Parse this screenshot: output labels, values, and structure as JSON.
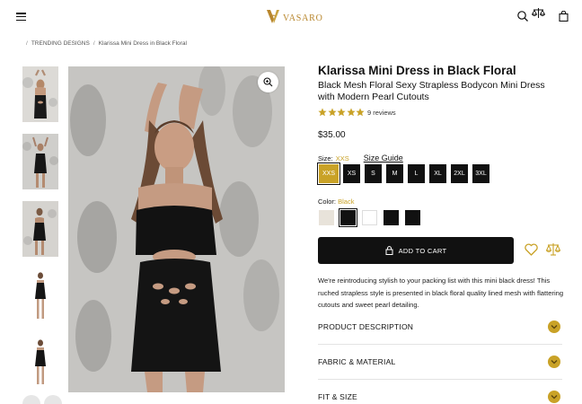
{
  "header": {
    "logo_text": "VASARO",
    "icons": [
      "menu-icon",
      "search-icon",
      "compare-icon",
      "bag-icon"
    ]
  },
  "breadcrumb": {
    "items": [
      "TRENDING DESIGNS",
      "Klarissa Mini Dress in Black Floral"
    ]
  },
  "product": {
    "title": "Klarissa Mini Dress in Black Floral",
    "subtitle": "Black Mesh Floral Sexy Strapless Bodycon Mini Dress with Modern Pearl Cutouts",
    "rating_stars": 5,
    "reviews": "9 reviews",
    "price": "$35.00",
    "description": "We're reintroducing stylish to your packing list with this mini black dress! This ruched strapless style is presented in black floral quality lined mesh with flattering cutouts and sweet pearl detailing."
  },
  "size": {
    "label": "Size:",
    "selected": "XXS",
    "guide_label": "Size Guide",
    "options": [
      "XXS",
      "XS",
      "S",
      "M",
      "L",
      "XL",
      "2XL",
      "3XL"
    ]
  },
  "color": {
    "label": "Color:",
    "selected": "Black",
    "swatches": [
      "#e8e3da",
      "#111111",
      "#ffffff",
      "#111111",
      "#111111"
    ]
  },
  "actions": {
    "add_to_cart": "ADD TO CART"
  },
  "accordions": [
    {
      "label": "PRODUCT DESCRIPTION"
    },
    {
      "label": "FABRIC & MATERIAL"
    },
    {
      "label": "FIT & SIZE"
    }
  ],
  "colors": {
    "accent": "#c9a227",
    "button": "#111111"
  }
}
